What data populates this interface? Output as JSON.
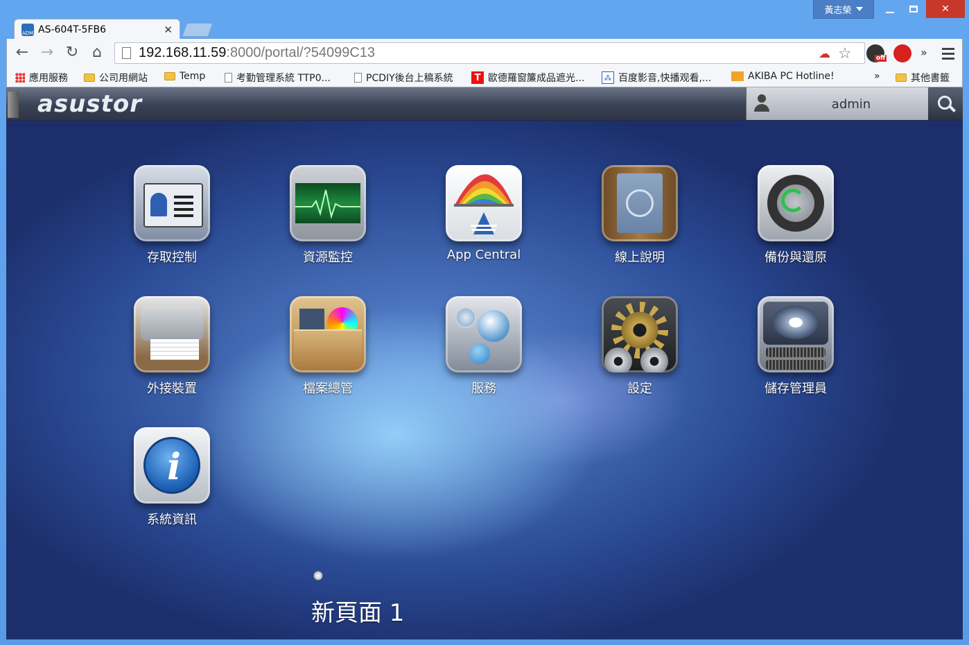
{
  "window": {
    "user": "黃志榮"
  },
  "tab": {
    "title": "AS-604T-5FB6",
    "favicon": "ADM"
  },
  "address": {
    "host": "192.168.11.59",
    "rest": ":8000/portal/?54099C13"
  },
  "bookmarks": {
    "items": [
      {
        "label": "應用服務",
        "icon": "apps-grid-icon"
      },
      {
        "label": "公司用網站",
        "icon": "folder-icon"
      },
      {
        "label": "Temp",
        "icon": "folder-icon"
      },
      {
        "label": "考勤管理系統 TTP0...",
        "icon": "page-icon"
      },
      {
        "label": "PCDIY後台上稿系統",
        "icon": "page-icon"
      },
      {
        "label": "歐德羅窗簾成品遮光...",
        "icon": "t-icon"
      },
      {
        "label": "百度影音,快播观看,...",
        "icon": "baidu-icon"
      },
      {
        "label": "AKIBA PC Hotline!",
        "icon": "akiba-icon"
      }
    ],
    "overflow": "»",
    "other": "其他書籤"
  },
  "extensions": {
    "off_badge": "off",
    "more": "»"
  },
  "portal": {
    "logo": "asustor",
    "user": "admin"
  },
  "apps": [
    {
      "label": "存取控制",
      "icon": "access-control-icon"
    },
    {
      "label": "資源監控",
      "icon": "resource-monitor-icon"
    },
    {
      "label": "App Central",
      "icon": "app-central-icon"
    },
    {
      "label": "線上說明",
      "icon": "online-help-icon"
    },
    {
      "label": "備份與還原",
      "icon": "backup-restore-icon"
    },
    {
      "label": "外接裝置",
      "icon": "external-devices-icon"
    },
    {
      "label": "檔案總管",
      "icon": "file-explorer-icon"
    },
    {
      "label": "服務",
      "icon": "services-icon"
    },
    {
      "label": "設定",
      "icon": "settings-icon"
    },
    {
      "label": "儲存管理員",
      "icon": "storage-manager-icon"
    },
    {
      "label": "系統資訊",
      "icon": "system-information-icon"
    }
  ],
  "pager": {
    "page_name": "新頁面 1"
  }
}
